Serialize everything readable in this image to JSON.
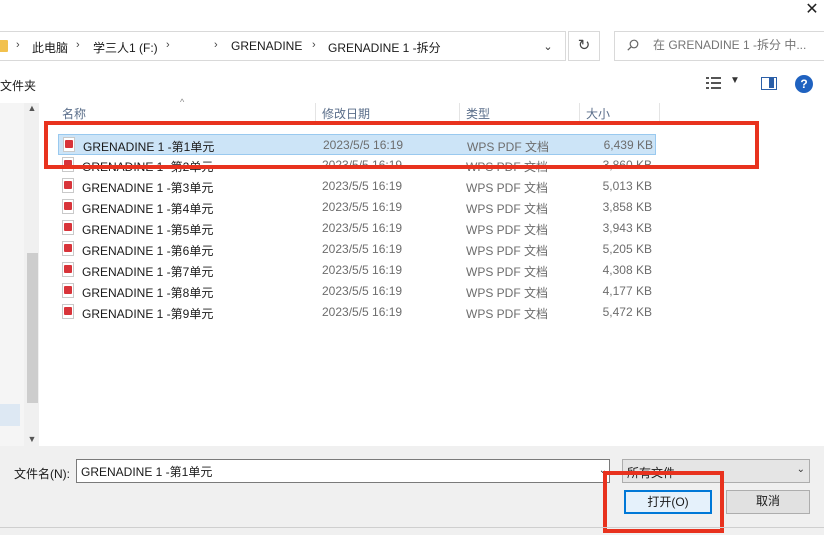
{
  "window": {
    "close_glyph": "✕"
  },
  "address": {
    "crumbs": [
      "此电脑",
      "学三人1 (F:)",
      "GRENADINE",
      "GRENADINE 1 -拆分"
    ],
    "separator": "›",
    "dropdown_glyph": "⌄",
    "refresh_glyph": "↻"
  },
  "search": {
    "placeholder": "在 GRENADINE 1 -拆分 中..."
  },
  "toolbar": {
    "new_folder_label": "文件夹",
    "help_glyph": "?"
  },
  "columns": {
    "name": "名称",
    "date": "修改日期",
    "type": "类型",
    "size": "大小"
  },
  "files": [
    {
      "name": "GRENADINE 1 -第1单元",
      "date": "2023/5/5 16:19",
      "type": "WPS PDF 文档",
      "size": "6,439 KB",
      "selected": true
    },
    {
      "name": "GRENADINE 1 -第2单元",
      "date": "2023/5/5 16:19",
      "type": "WPS PDF 文档",
      "size": "3,860 KB"
    },
    {
      "name": "GRENADINE 1 -第3单元",
      "date": "2023/5/5 16:19",
      "type": "WPS PDF 文档",
      "size": "5,013 KB"
    },
    {
      "name": "GRENADINE 1 -第4单元",
      "date": "2023/5/5 16:19",
      "type": "WPS PDF 文档",
      "size": "3,858 KB"
    },
    {
      "name": "GRENADINE 1 -第5单元",
      "date": "2023/5/5 16:19",
      "type": "WPS PDF 文档",
      "size": "3,943 KB"
    },
    {
      "name": "GRENADINE 1 -第6单元",
      "date": "2023/5/5 16:19",
      "type": "WPS PDF 文档",
      "size": "5,205 KB"
    },
    {
      "name": "GRENADINE 1 -第7单元",
      "date": "2023/5/5 16:19",
      "type": "WPS PDF 文档",
      "size": "4,308 KB"
    },
    {
      "name": "GRENADINE 1 -第8单元",
      "date": "2023/5/5 16:19",
      "type": "WPS PDF 文档",
      "size": "4,177 KB"
    },
    {
      "name": "GRENADINE 1 -第9单元",
      "date": "2023/5/5 16:19",
      "type": "WPS PDF 文档",
      "size": "5,472 KB"
    }
  ],
  "footer": {
    "filename_label": "文件名(N):",
    "filename_value": "GRENADINE 1 -第1单元",
    "filter_value": "所有文件",
    "open_label": "打开(O)",
    "cancel_label": "取消"
  },
  "colors": {
    "highlight": "#e8321e",
    "selection": "#cce4f7",
    "accent": "#0078d7"
  }
}
